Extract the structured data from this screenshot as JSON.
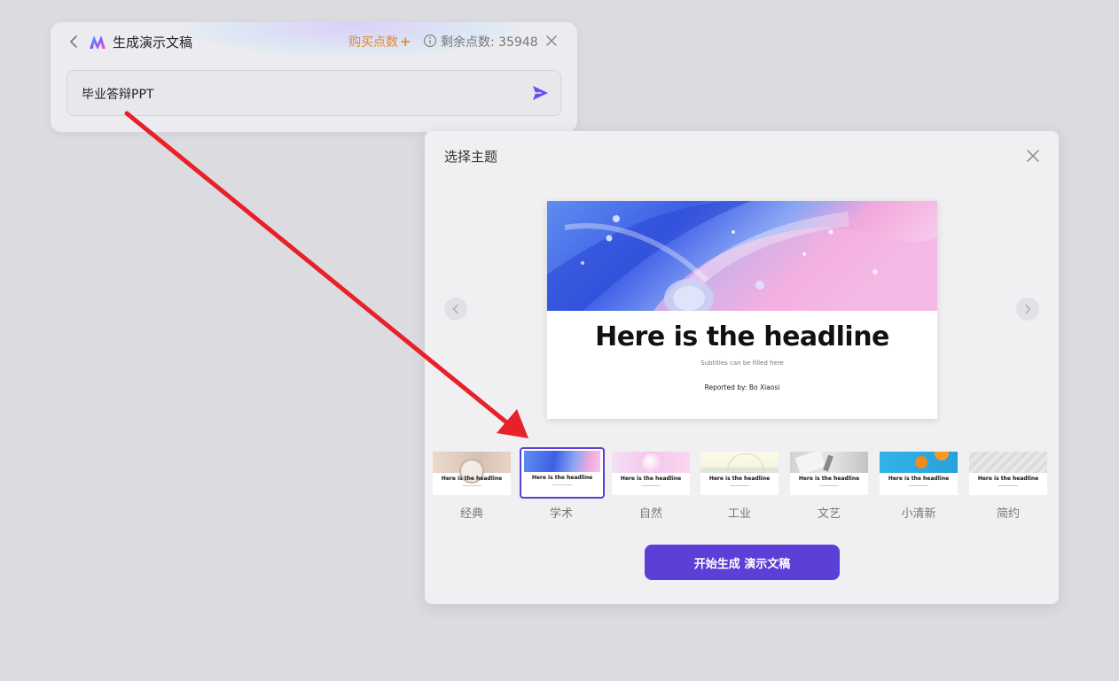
{
  "generator": {
    "title": "生成演示文稿",
    "buy_points_label": "购买点数",
    "buy_points_plus": "+",
    "remaining_points_label": "剩余点数: 35948",
    "input_value": "毕业答辩PPT",
    "icons": {
      "back": "chevron-left-icon",
      "logo": "app-logo-icon",
      "info": "info-icon",
      "close": "close-icon",
      "send": "send-icon"
    }
  },
  "theme_dialog": {
    "title": "选择主题",
    "preview": {
      "headline": "Here is the headline",
      "subtitle": "Subtitles can be filled here",
      "reported_by": "Reported by:  Bo Xiaosi"
    },
    "themes": [
      {
        "label": "经典",
        "headline": "Here is the headline",
        "selected": false,
        "colors": [
          "#e8d5c8",
          "#c8b6a8"
        ]
      },
      {
        "label": "学术",
        "headline": "Here is the headline",
        "selected": true,
        "colors": [
          "#3d63e0",
          "#e9a6dc"
        ]
      },
      {
        "label": "自然",
        "headline": "Here is the headline",
        "selected": false,
        "colors": [
          "#f6c6ec",
          "#f3e0f5"
        ]
      },
      {
        "label": "工业",
        "headline": "Here is the headline",
        "selected": false,
        "colors": [
          "#f7f6dc",
          "#dfe8d8"
        ]
      },
      {
        "label": "文艺",
        "headline": "Here is the headline",
        "selected": false,
        "colors": [
          "#d8d8d8",
          "#a6a6a6"
        ]
      },
      {
        "label": "小清新",
        "headline": "Here is the headline",
        "selected": false,
        "colors": [
          "#2fa6e0",
          "#f28a1e"
        ]
      },
      {
        "label": "简约",
        "headline": "Here is the headline",
        "selected": false,
        "colors": [
          "#e6e6e6",
          "#d4d4d4"
        ]
      }
    ],
    "start_button_label": "开始生成 演示文稿"
  },
  "colors": {
    "accent": "#5b3fd6",
    "buy_points": "#e28a2b",
    "annotation_arrow": "#e8202a"
  }
}
